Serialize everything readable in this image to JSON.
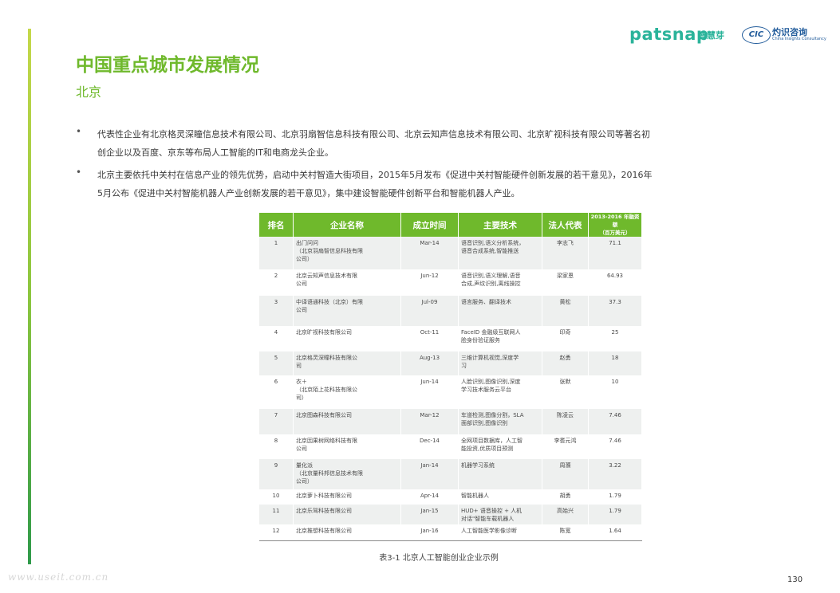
{
  "header": {
    "logo_patsnap": "patsnap",
    "logo_patsnap_cn": "智慧芽",
    "logo_cic": "CIC",
    "logo_cic_cn": "灼识咨询",
    "logo_cic_en": "China Insights Consultancy"
  },
  "page": {
    "title": "中国重点城市发展情况",
    "subtitle": "北京",
    "page_number": "130",
    "watermark": "www.useit.com.cn"
  },
  "colors": {
    "accent": "#6fb92c",
    "row_shade": "#eef0ef",
    "logo_green": "#2ab39a",
    "logo_blue": "#1f5a9a"
  },
  "bullets": [
    {
      "lines": [
        "代表性企业有北京格灵深瞳信息技术有限公司、北京羽扇智信息科技有限公司、北京云知声信息技术有限公司、北京旷视科技有限公司等著名初",
        "创企业以及百度、京东等布局人工智能的IT和电商龙头企业。"
      ]
    },
    {
      "lines": [
        "北京主要依托中关村在信息产业的领先优势，启动中关村智造大街项目，2015年5月发布《促进中关村智能硬件创新发展的若干意见》，2016年",
        "5月公布《促进中关村智能机器人产业创新发展的若干意见》，集中建设智能硬件创新平台和智能机器人产业。"
      ]
    }
  ],
  "table": {
    "headers": [
      "排名",
      "企业名称",
      "成立时间",
      "主要技术",
      "法人代表",
      "2013-2016 年融资额",
      "（百万美元）"
    ],
    "rows": [
      {
        "rank": "1",
        "name": [
          "出门问问",
          "（北京羽扇智信息科技有限",
          "公司）"
        ],
        "date": "Mar-14",
        "tech": [
          "语音识别,语义分析系统，",
          "语音合成系统,智能推送"
        ],
        "rep": "李志飞",
        "fund": "71.1"
      },
      {
        "rank": "2",
        "name": [
          "北京云知声信息技术有限",
          "公司"
        ],
        "date": "Jun-12",
        "tech": [
          "语音识别,语义理解,语音",
          "合成,声纹识别,离线操控"
        ],
        "rep": "梁家恩",
        "fund": "64.93"
      },
      {
        "rank": "3",
        "name": [
          "中译语通科技（北京）有限",
          "公司"
        ],
        "date": "Jul-09",
        "tech": [
          "语言服务、翻译技术"
        ],
        "rep": "黄松",
        "fund": "37.3"
      },
      {
        "rank": "4",
        "name": [
          "北京旷视科技有限公司"
        ],
        "date": "Oct-11",
        "tech": [
          "FaceID 金融级互联网人",
          "脸身份验证服务"
        ],
        "rep": "印奇",
        "fund": "25"
      },
      {
        "rank": "5",
        "name": [
          "北京格灵深瞳科技有限公",
          "司"
        ],
        "date": "Aug-13",
        "tech": [
          "三维计算机视觉,深度学",
          "习"
        ],
        "rep": "赵勇",
        "fund": "18"
      },
      {
        "rank": "6",
        "name": [
          "衣＋",
          "（北京陌上花科技有限公",
          "司）"
        ],
        "date": "Jun-14",
        "tech": [
          "人脸识别,图像识别,深度",
          "学习技术服务云平台"
        ],
        "rep": "张默",
        "fund": "10"
      },
      {
        "rank": "7",
        "name": [
          "北京图森科技有限公司"
        ],
        "date": "Mar-12",
        "tech": [
          "车道检测,图像分割，SLA",
          "面部识别,图像识别"
        ],
        "rep": "陈凌云",
        "fund": "7.46"
      },
      {
        "rank": "8",
        "name": [
          "北京因果树网络科技有限",
          "公司"
        ],
        "date": "Dec-14",
        "tech": [
          "全网项目数据库，人工智",
          "能投资,优质项目预测"
        ],
        "rep": "李耆元鸿",
        "fund": "7.46"
      },
      {
        "rank": "9",
        "name": [
          "量化派",
          "（北京量科邦信息技术有限",
          "公司）"
        ],
        "date": "Jan-14",
        "tech": [
          "机器学习系统"
        ],
        "rep": "周灝",
        "fund": "3.22"
      },
      {
        "rank": "10",
        "name": [
          "北京萝卜科技有限公司"
        ],
        "date": "Apr-14",
        "tech": [
          "智能机器人"
        ],
        "rep": "胡勇",
        "fund": "1.79"
      },
      {
        "rank": "11",
        "name": [
          "北京乐驾科技有限公司"
        ],
        "date": "Jan-15",
        "tech": [
          "HUD+ 语音操控 + 人机",
          "对话\"智能车载机器人"
        ],
        "rep": "高始兴",
        "fund": "1.79"
      },
      {
        "rank": "12",
        "name": [
          "北京推想科技有限公司"
        ],
        "date": "Jan-16",
        "tech": [
          "人工智能医学影像诊断"
        ],
        "rep": "陈宽",
        "fund": "1.64"
      }
    ],
    "caption": "表3-1 北京人工智能创业企业示例"
  }
}
